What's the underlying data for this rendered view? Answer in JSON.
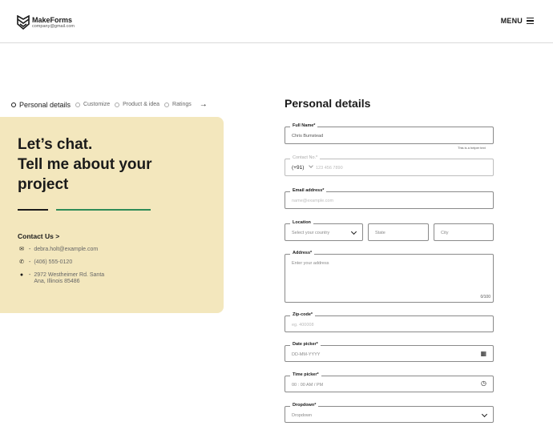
{
  "header": {
    "brand_name": "MakeForms",
    "brand_email": "company@gmail.com",
    "menu_label": "MENU"
  },
  "stepper": {
    "steps": [
      {
        "label": "Personal details",
        "active": true
      },
      {
        "label": "Customize",
        "active": false
      },
      {
        "label": "Product & idea",
        "active": false
      },
      {
        "label": "Ratings",
        "active": false
      }
    ],
    "next_icon": "arrow-right-icon"
  },
  "card": {
    "headline_lines": [
      "Let’s chat.",
      "Tell me about your",
      "project"
    ],
    "contact_title": "Contact Us",
    "contact_chevron": ">",
    "email": "debra.holt@example.com",
    "phone": "(406) 555-0120",
    "address_line1": "2972 Westheimer Rd. Santa",
    "address_line2": "Ana, Illinois 85486",
    "accent_color": "#f3e7bd",
    "line_color": "#2e8b57"
  },
  "form": {
    "title": "Personal details",
    "full_name": {
      "label": "Full Name*",
      "value": "Chris Bumstead",
      "helper": "This is a helper text"
    },
    "contact_no": {
      "label": "Contact No.*",
      "prefix": "(+91)",
      "placeholder": "123 456 7890"
    },
    "email": {
      "label": "Email address*",
      "placeholder": "name@example.com"
    },
    "location": {
      "label": "Location",
      "country_placeholder": "Select your country",
      "state_placeholder": "State",
      "city_placeholder": "City"
    },
    "address": {
      "label": "Address*",
      "placeholder": "Enter your address",
      "counter": "0/100"
    },
    "zip": {
      "label": "Zip-code*",
      "placeholder": "eg. 400008"
    },
    "date": {
      "label": "Date picker*",
      "placeholder": "DD-MM-YYYY"
    },
    "time": {
      "label": "Time picker*",
      "placeholder": "00 : 00 AM / PM"
    },
    "dropdown": {
      "label": "Dropdown*",
      "placeholder": "Dropdown"
    }
  }
}
